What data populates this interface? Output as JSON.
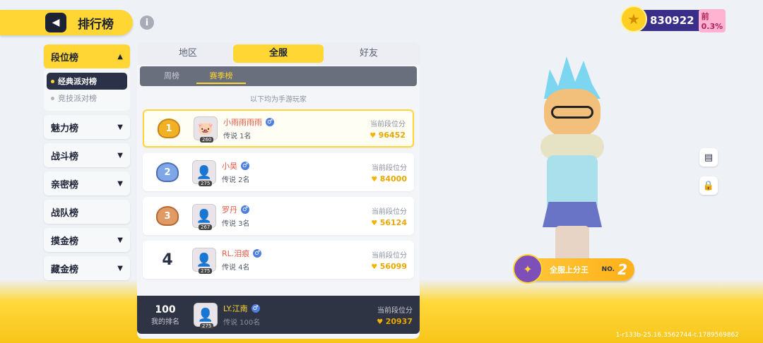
{
  "header": {
    "title": "排行榜",
    "back_icon": "back-arrow-icon",
    "info_icon": "info-icon"
  },
  "score": {
    "value": "830922",
    "percent": "前0.3%"
  },
  "sidebar": {
    "items": [
      {
        "label": "段位榜",
        "active": true
      },
      {
        "label": "魅力榜"
      },
      {
        "label": "战斗榜"
      },
      {
        "label": "亲密榜"
      },
      {
        "label": "战队榜"
      },
      {
        "label": "摸金榜"
      },
      {
        "label": "藏金榜"
      }
    ],
    "sub_items": [
      {
        "label": "经典派对榜",
        "selected": true
      },
      {
        "label": "竞技派对榜"
      }
    ]
  },
  "tabs": [
    "地区",
    "全服",
    "好友"
  ],
  "subtabs": [
    "周榜",
    "赛季榜"
  ],
  "note": "以下均为手游玩家",
  "rows": [
    {
      "rank": "1",
      "level": "260",
      "name": "小雨雨雨雨",
      "title": "传说 1名",
      "label": "当前段位分",
      "points": "96452"
    },
    {
      "rank": "2",
      "level": "275",
      "name": "小昊",
      "title": "传说 2名",
      "label": "当前段位分",
      "points": "84000"
    },
    {
      "rank": "3",
      "level": "267",
      "name": "罗丹",
      "title": "传说 3名",
      "label": "当前段位分",
      "points": "56124"
    },
    {
      "rank": "4",
      "level": "275",
      "name": "RL.泪痕",
      "title": "传说 4名",
      "label": "当前段位分",
      "points": "56099"
    }
  ],
  "my_row": {
    "rank": "100",
    "rank_label": "我的排名",
    "level": "275",
    "name": "LY.江南",
    "title": "传说 100名",
    "label": "当前段位分",
    "points": "20937"
  },
  "rank_tag": {
    "text": "全服上分王",
    "no": "NO.",
    "num": "2"
  },
  "version": "1-r133b-25.16.3562744-t.1789569862",
  "colors": {
    "accent": "#ffd633",
    "dark": "#2b3147"
  }
}
